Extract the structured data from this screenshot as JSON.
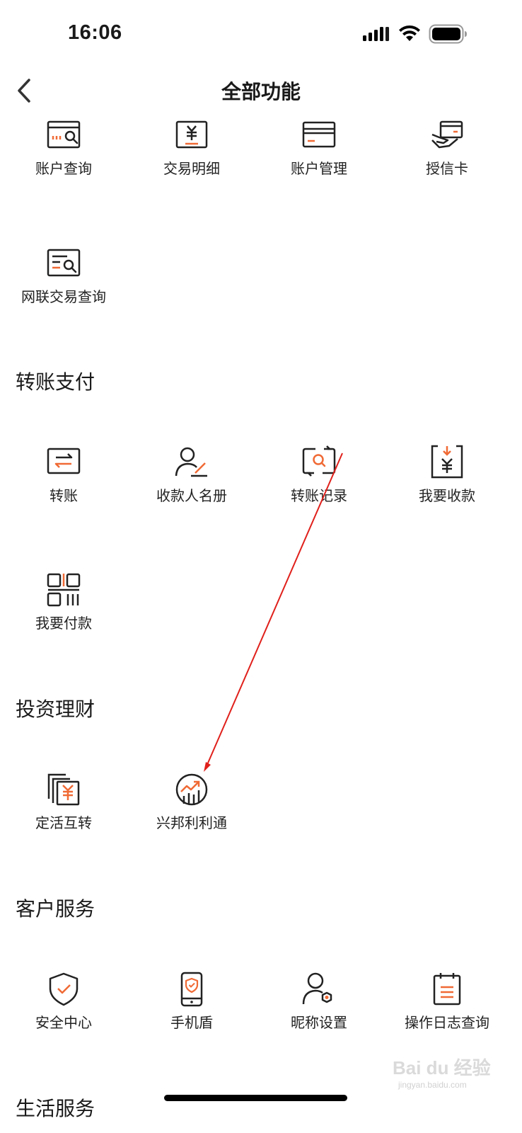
{
  "status_bar": {
    "time": "16:06"
  },
  "nav": {
    "title": "全部功能"
  },
  "colors": {
    "accent": "#f06a35",
    "ink": "#222222",
    "annotation": "#e0201b"
  },
  "account_section": {
    "items": [
      {
        "label": "账户查询",
        "icon": "account-search-icon"
      },
      {
        "label": "交易明细",
        "icon": "transaction-detail-icon"
      },
      {
        "label": "账户管理",
        "icon": "card-manage-icon"
      },
      {
        "label": "授信卡",
        "icon": "credit-card-hand-icon"
      },
      {
        "label": "网联交易查询",
        "icon": "netunion-search-icon"
      }
    ]
  },
  "transfer_section": {
    "title": "转账支付",
    "items": [
      {
        "label": "转账",
        "icon": "transfer-icon"
      },
      {
        "label": "收款人名册",
        "icon": "payee-list-icon"
      },
      {
        "label": "转账记录",
        "icon": "transfer-record-icon"
      },
      {
        "label": "我要收款",
        "icon": "receive-money-icon"
      },
      {
        "label": "我要付款",
        "icon": "pay-qrcode-icon"
      }
    ]
  },
  "investment_section": {
    "title": "投资理财",
    "items": [
      {
        "label": "定活互转",
        "icon": "deposit-convert-icon"
      },
      {
        "label": "兴邦利利通",
        "icon": "growth-chart-icon"
      }
    ]
  },
  "service_section": {
    "title": "客户服务",
    "items": [
      {
        "label": "安全中心",
        "icon": "security-shield-icon"
      },
      {
        "label": "手机盾",
        "icon": "phone-shield-icon"
      },
      {
        "label": "昵称设置",
        "icon": "nickname-settings-icon"
      },
      {
        "label": "操作日志查询",
        "icon": "operation-log-icon"
      }
    ]
  },
  "life_section": {
    "title": "生活服务"
  },
  "watermark": {
    "text": "Bai du 经验",
    "subtext": "jingyan.baidu.com"
  }
}
